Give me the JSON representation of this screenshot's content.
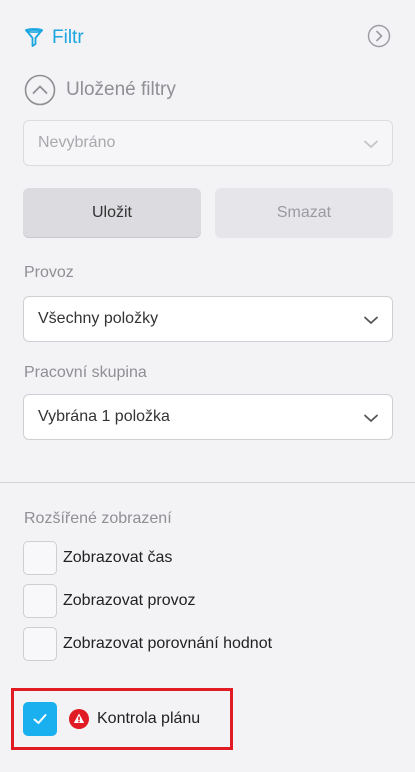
{
  "header": {
    "title": "Filtr",
    "accent_color": "#1aa6e0"
  },
  "saved_filters": {
    "title": "Uložené filtry",
    "select_value": "Nevybráno",
    "save_label": "Uložit",
    "delete_label": "Smazat"
  },
  "provoz": {
    "label": "Provoz",
    "value": "Všechny položky"
  },
  "work_group": {
    "label": "Pracovní skupina",
    "value": "Vybrána 1 položka"
  },
  "extended": {
    "label": "Rozšířené zobrazení",
    "options": [
      {
        "label": "Zobrazovat čas",
        "checked": false
      },
      {
        "label": "Zobrazovat provoz",
        "checked": false
      },
      {
        "label": "Zobrazovat porovnání hodnot",
        "checked": false
      }
    ]
  },
  "plan_check": {
    "label": "Kontrola plánu",
    "checked": true,
    "warning_color": "#e01b24",
    "check_color": "#1ab0f0"
  }
}
